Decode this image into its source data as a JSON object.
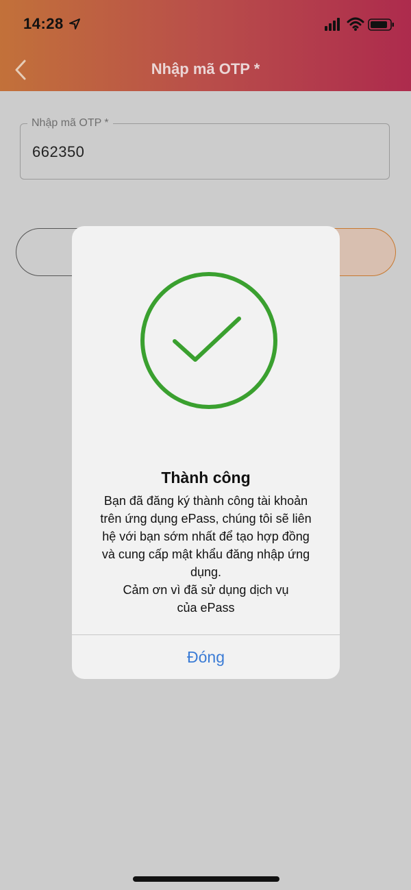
{
  "status_bar": {
    "time": "14:28",
    "icons": [
      "location-arrow-icon",
      "signal-icon",
      "wifi-icon",
      "battery-icon"
    ]
  },
  "header": {
    "title": "Nhập mã OTP *",
    "back_icon": "chevron-left-icon",
    "gradient": [
      "#c2713a",
      "#b94e4a",
      "#ad2b4d"
    ]
  },
  "otp_field": {
    "label": "Nhập mã OTP *",
    "value": "662350"
  },
  "dialog": {
    "icon": "check-circle-icon",
    "icon_color": "#3aa02f",
    "title": "Thành công",
    "message_lines": [
      "Bạn đã đăng ký thành công tài khoản",
      "trên ứng dụng ePass, chúng tôi sẽ liên",
      "hệ với bạn sớm nhất để tạo hợp đồng",
      "và cung cấp mật khẩu đăng nhập ứng",
      "dụng.",
      "Cảm ơn vì đã sử dụng dịch vụ",
      "của ePass"
    ],
    "close_label": "Đóng",
    "close_color": "#3a7bd5"
  }
}
